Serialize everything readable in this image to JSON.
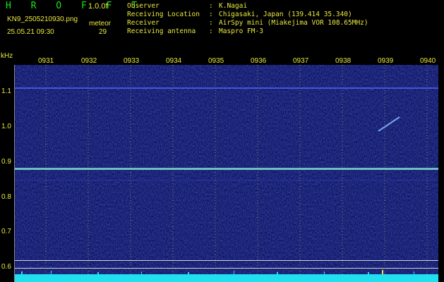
{
  "header": {
    "brand": "H R O F F T",
    "version": "1.0.0f",
    "filename": "KN9_2505210930.png",
    "meteor_label": "meteor",
    "datetime": "25.05.21 09:30",
    "meteor_count": "29"
  },
  "info": [
    {
      "key": "Observer",
      "value": "K.Nagai"
    },
    {
      "key": "Receiving Location",
      "value": "Chigasaki, Japan (139.414 35.340)"
    },
    {
      "key": "Receiver",
      "value": "AirSpy mini (Miakejima VOR 108.65MHz)"
    },
    {
      "key": "Receiving antenna",
      "value": "Maspro FM-3"
    }
  ],
  "axis": {
    "unit": "kHz",
    "time_ticks": [
      "0931",
      "0932",
      "0933",
      "0934",
      "0935",
      "0936",
      "0937",
      "0938",
      "0939",
      "0940"
    ],
    "freq_ticks": [
      "1.1",
      "1.0",
      "0.9",
      "0.8",
      "0.7",
      "0.6"
    ]
  },
  "colors": {
    "background": "#000000",
    "label": "#e8e840",
    "brand": "#18e818",
    "spectrogram": "#0a0a52",
    "carrier_line": "#7fd8d0",
    "noise_floor": "#20e0f0"
  }
}
